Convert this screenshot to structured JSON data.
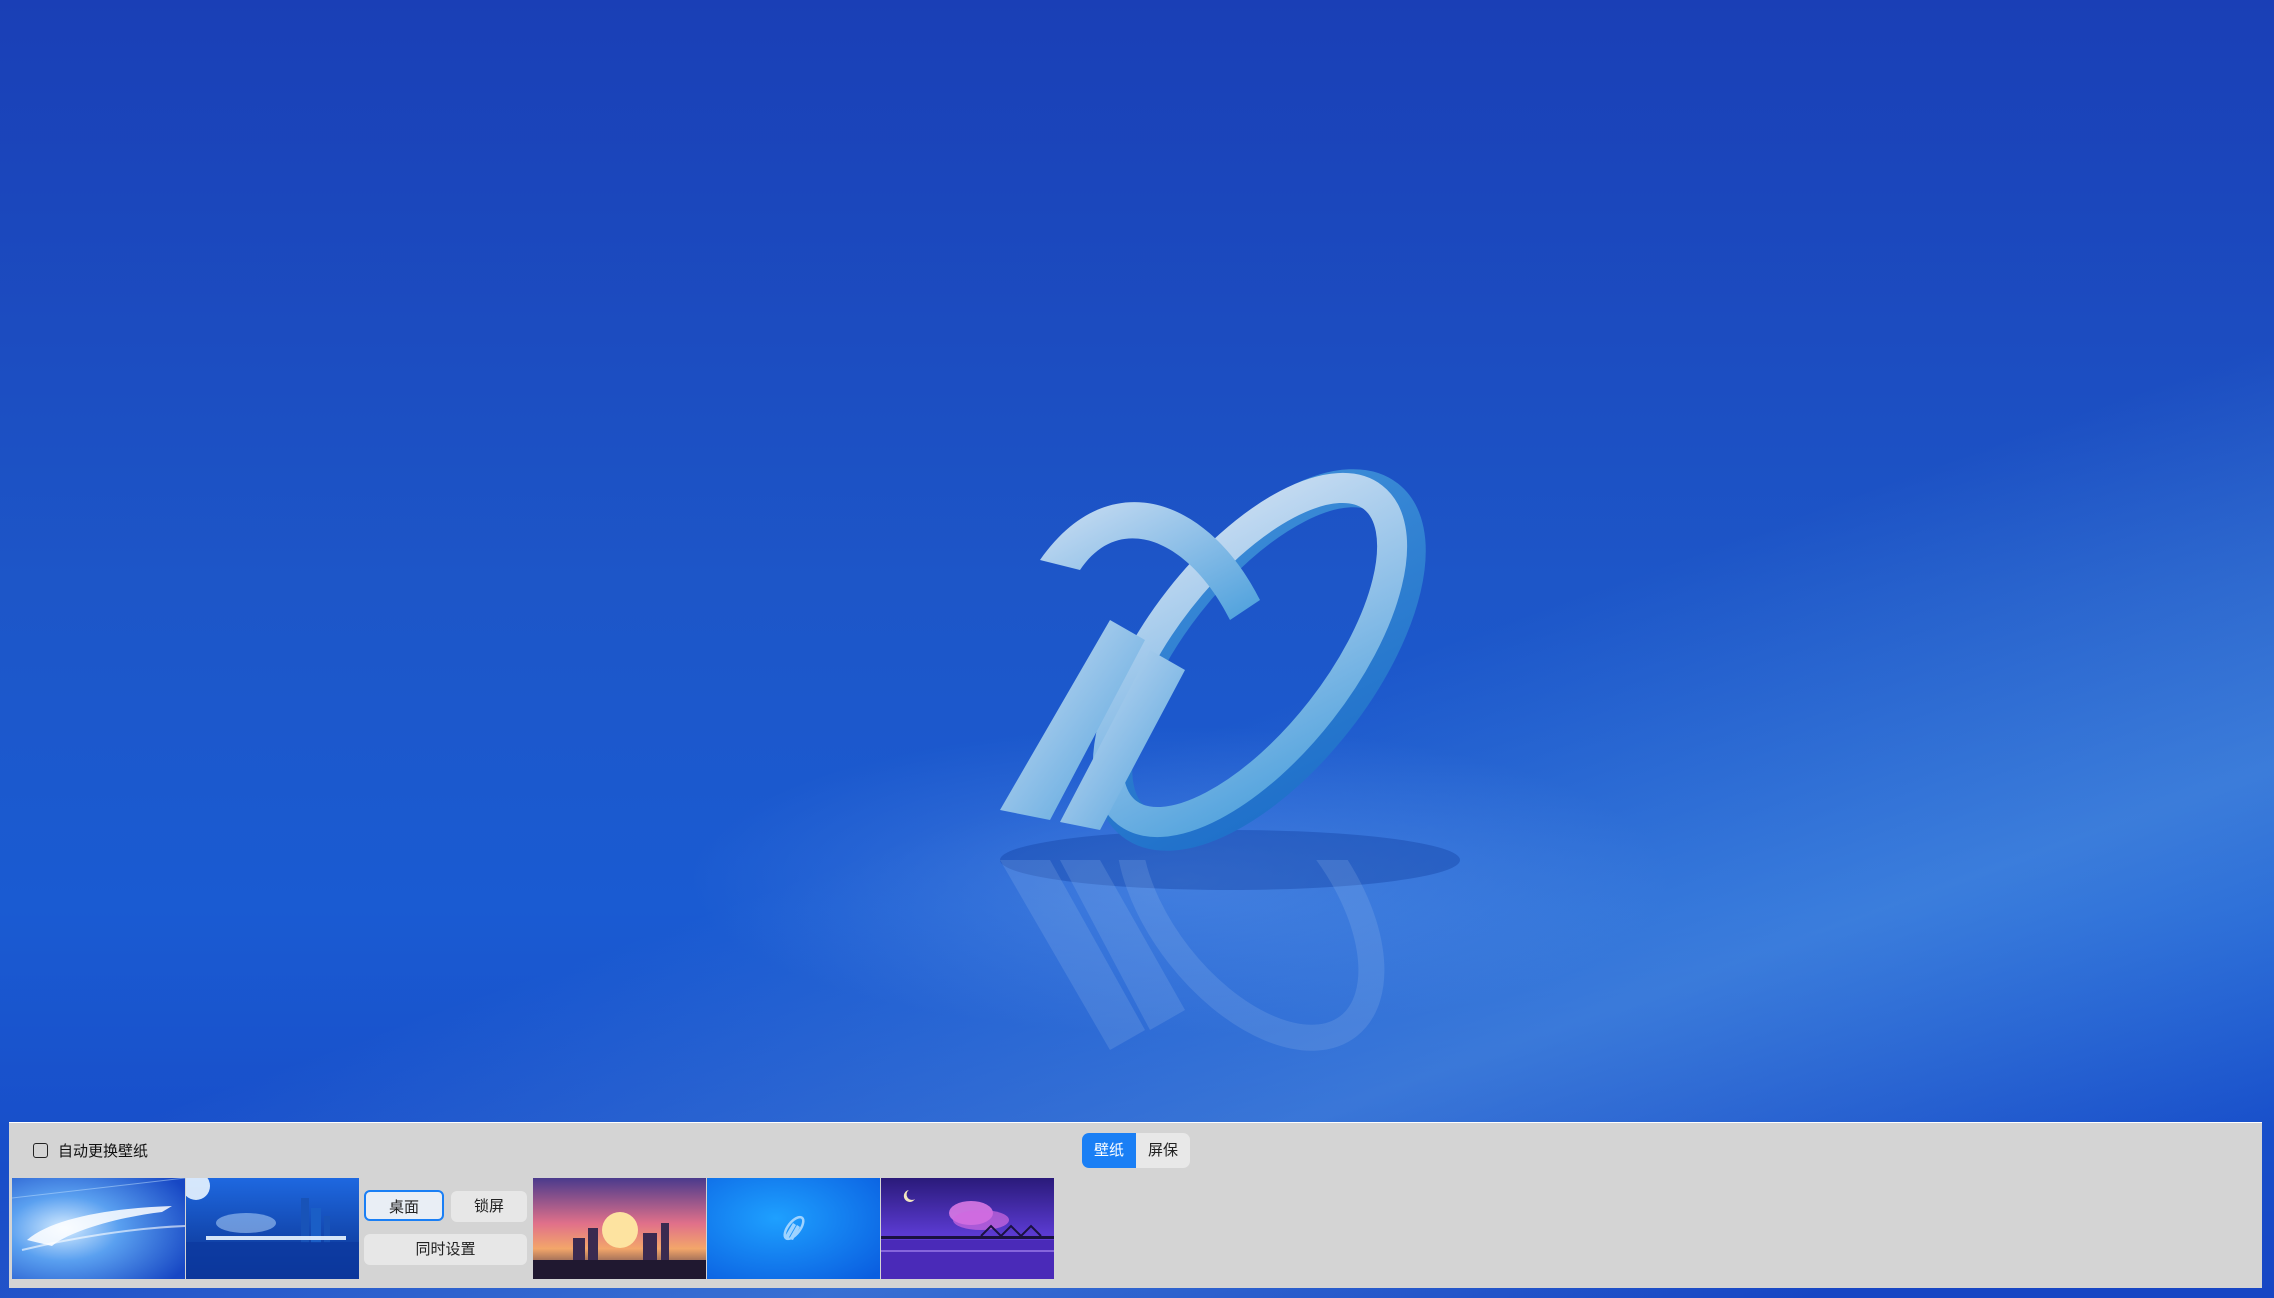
{
  "desktop": {
    "wallpaper": "blue-3d-x-logo",
    "background_color": "#1d56c8"
  },
  "panel": {
    "auto_change_label": "自动更换壁纸",
    "auto_change_checked": false,
    "mode_tabs": [
      {
        "label": "壁纸",
        "active": true
      },
      {
        "label": "屏保",
        "active": false
      }
    ],
    "set_buttons": {
      "desktop": "桌面",
      "lock": "锁屏",
      "both": "同时设置"
    },
    "thumbnails": [
      {
        "name": "bullet-train-light-streak",
        "selected": false
      },
      {
        "name": "city-skyline-train",
        "selected": true
      },
      {
        "name": "sunset-city",
        "selected": false
      },
      {
        "name": "blue-x-logo",
        "selected": false
      },
      {
        "name": "purple-night-bridge",
        "selected": false
      }
    ],
    "accent_color": "#1a7ff5",
    "panel_color": "#d4d4d4"
  }
}
